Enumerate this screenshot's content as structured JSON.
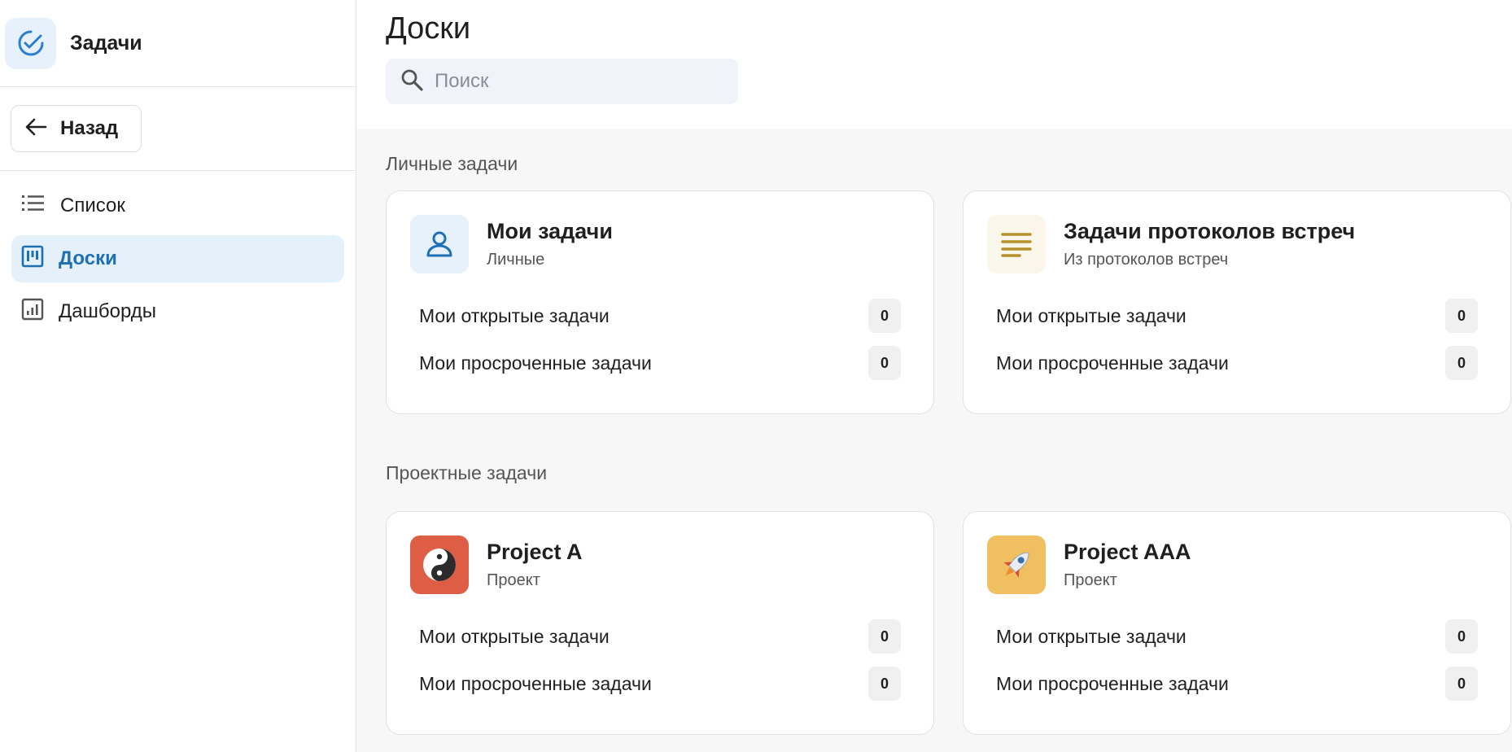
{
  "app": {
    "title": "Задачи"
  },
  "sidebar": {
    "back_label": "Назад",
    "items": [
      {
        "label": "Список",
        "icon": "list-icon",
        "active": false
      },
      {
        "label": "Доски",
        "icon": "board-icon",
        "active": true
      },
      {
        "label": "Дашборды",
        "icon": "dashboard-icon",
        "active": false
      }
    ]
  },
  "main": {
    "title": "Доски",
    "search": {
      "placeholder": "Поиск",
      "value": ""
    },
    "sections": [
      {
        "title": "Личные задачи",
        "cards": [
          {
            "title": "Мои задачи",
            "subtitle": "Личные",
            "icon": "person-icon",
            "icon_bg": "#e6f1fb",
            "stats": [
              {
                "label": "Мои открытые задачи",
                "count": "0"
              },
              {
                "label": "Мои просроченные задачи",
                "count": "0"
              }
            ]
          },
          {
            "title": "Задачи протоколов встреч",
            "subtitle": "Из протоколов встреч",
            "icon": "lines-icon",
            "icon_bg": "#fbf6ea",
            "stats": [
              {
                "label": "Мои открытые задачи",
                "count": "0"
              },
              {
                "label": "Мои просроченные задачи",
                "count": "0"
              }
            ]
          }
        ]
      },
      {
        "title": "Проектные задачи",
        "cards": [
          {
            "title": "Project A",
            "subtitle": "Проект",
            "icon": "yin-yang-icon",
            "icon_bg": "#dd5e44",
            "stats": [
              {
                "label": "Мои открытые задачи",
                "count": "0"
              },
              {
                "label": "Мои просроченные задачи",
                "count": "0"
              }
            ]
          },
          {
            "title": "Project AAA",
            "subtitle": "Проект",
            "icon": "rocket-icon",
            "icon_bg": "#efbf60",
            "stats": [
              {
                "label": "Мои открытые задачи",
                "count": "0"
              },
              {
                "label": "Мои просроченные задачи",
                "count": "0"
              }
            ]
          }
        ]
      }
    ]
  },
  "colors": {
    "accent": "#1f6fb5",
    "active_bg": "#e4f1fb",
    "content_bg": "#f7f7f7"
  }
}
